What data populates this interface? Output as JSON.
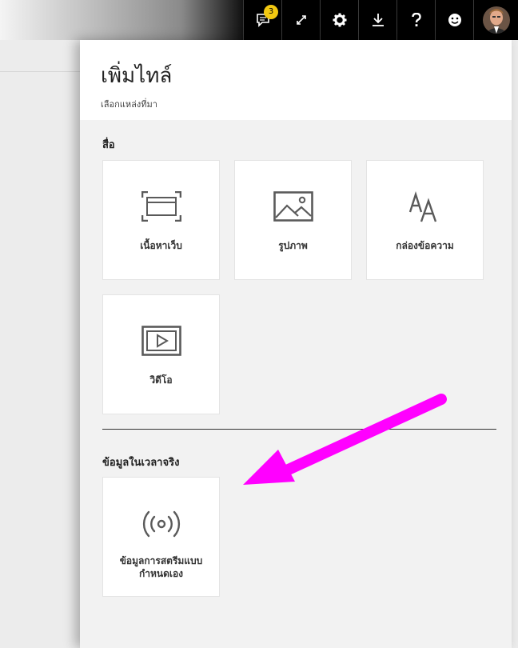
{
  "toolbar": {
    "notification_count": "3",
    "icons": [
      "notification-icon",
      "expand-icon",
      "gear-icon",
      "download-icon",
      "help-icon",
      "smiley-icon",
      "user-avatar"
    ]
  },
  "panel": {
    "title": "เพิ่มไทล์",
    "subtitle": "เลือกแหล่งที่มา"
  },
  "sections": {
    "media": {
      "label": "สื่อ",
      "tiles": [
        {
          "label": "เนื้อหาเว็บ",
          "icon": "web-content-icon"
        },
        {
          "label": "รูปภาพ",
          "icon": "image-icon"
        },
        {
          "label": "กล่องข้อความ",
          "icon": "text-box-icon"
        },
        {
          "label": "วิดีโอ",
          "icon": "video-icon"
        }
      ]
    },
    "realtime": {
      "label": "ข้อมูลในเวลาจริง",
      "tiles": [
        {
          "label": "ข้อมูลการสตรีมแบบกำหนดเอง",
          "icon": "streaming-icon"
        }
      ]
    }
  },
  "colors": {
    "accent_arrow": "#ff00ff",
    "badge": "#f2c811",
    "toolbar_bg": "#000000",
    "icon_gray": "#5a5a5a"
  }
}
